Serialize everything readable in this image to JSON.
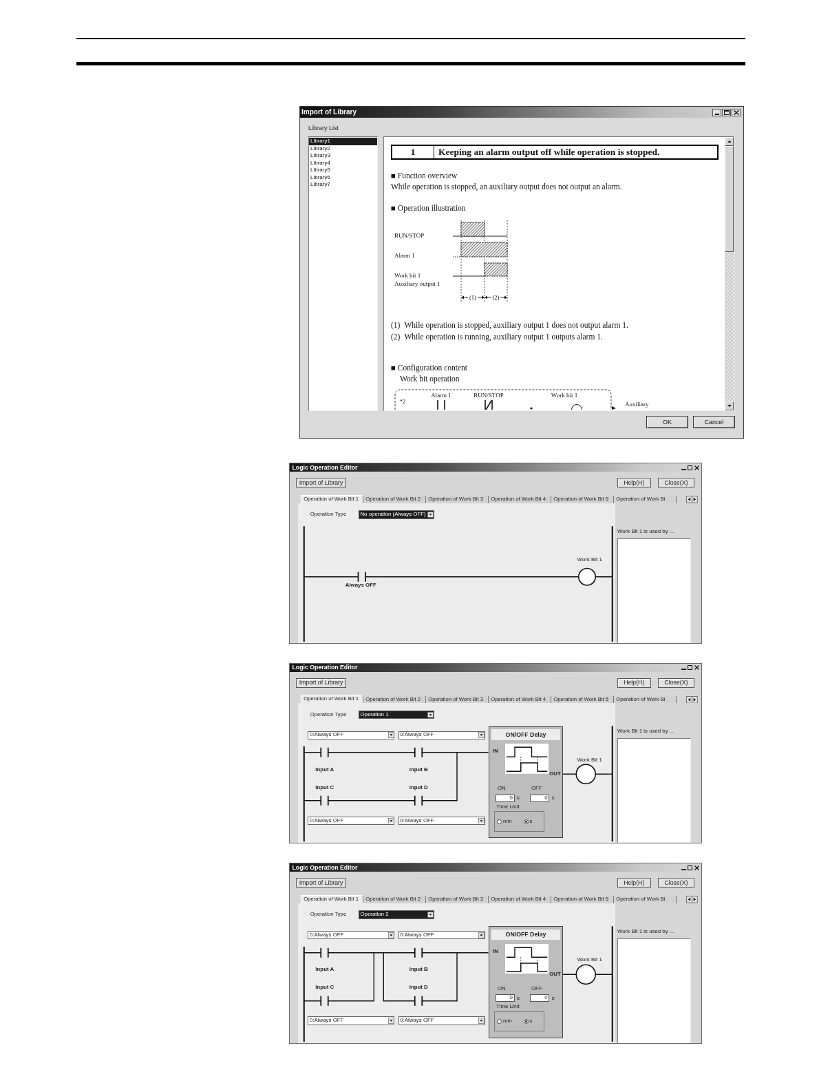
{
  "dialog": {
    "title": "Import of Library",
    "list_label": "Library List",
    "libraries": [
      {
        "label": "Library1",
        "selected": true
      },
      {
        "label": "Library2",
        "selected": false
      },
      {
        "label": "Library3",
        "selected": false
      },
      {
        "label": "Library4",
        "selected": false
      },
      {
        "label": "Library5",
        "selected": false
      },
      {
        "label": "Library6",
        "selected": false
      },
      {
        "label": "Library7",
        "selected": false
      }
    ],
    "document": {
      "number": "1",
      "heading": "Keeping an alarm output off while operation is stopped.",
      "overview_title": "■ Function overview",
      "overview_text": "While operation is stopped, an auxiliary output does not output an alarm.",
      "illustration_title": "■ Operation illustration",
      "signals": [
        {
          "label": "RUN/STOP"
        },
        {
          "label": "Alarm 1"
        },
        {
          "label": "Work bit 1",
          "sublabel": "Auxiliary output 1"
        }
      ],
      "intervals": [
        "(1)",
        "(2)"
      ],
      "notes": [
        {
          "marker": "(1)",
          "text": "While operation is stopped, auxiliary output 1 does not output alarm 1."
        },
        {
          "marker": "(2)",
          "text": "While operation is running, auxiliary output 1 outputs alarm 1."
        }
      ],
      "configuration_title": "■ Configuration content",
      "configuration_subtitle": "Work bit operation",
      "configuration_diagram": {
        "note_mark": "*2",
        "contacts": [
          {
            "label": "Alarm 1",
            "kind": "normally_open"
          },
          {
            "label": "RUN/STOP",
            "kind": "normally_closed"
          }
        ],
        "coil": "Work bit 1",
        "output": "Auxiliary"
      }
    },
    "buttons": [
      "OK",
      "Cancel"
    ]
  },
  "editors": [
    {
      "kind": "single_contact",
      "title": "Logic Operation Editor",
      "import_button": "Import of Library",
      "help_button": "Help(H)",
      "close_button": "Close(X)",
      "tabs": [
        {
          "label": "Operation of Work Bit 1",
          "selected": true
        },
        {
          "label": "Operation of Work Bit 2",
          "selected": false
        },
        {
          "label": "Operation of Work Bit 3",
          "selected": false
        },
        {
          "label": "Operation of Work Bit 4",
          "selected": false
        },
        {
          "label": "Operation of Work Bit 5",
          "selected": false
        },
        {
          "label": "Operation of Work Bi",
          "selected": false
        }
      ],
      "operation_type": {
        "label": "Operation Type",
        "value": "No operation (Always OFF)",
        "highlighted": true
      },
      "contact_label": "Always OFF",
      "coil_label": "Work Bit 1",
      "usage_title": "Work Bit 1 is used by ..."
    },
    {
      "kind": "and_or",
      "title": "Logic Operation Editor",
      "import_button": "Import of Library",
      "help_button": "Help(H)",
      "close_button": "Close(X)",
      "tabs": [
        {
          "label": "Operation of Work Bit 1",
          "selected": true
        },
        {
          "label": "Operation of Work Bit 2",
          "selected": false
        },
        {
          "label": "Operation of Work Bit 3",
          "selected": false
        },
        {
          "label": "Operation of Work Bit 4",
          "selected": false
        },
        {
          "label": "Operation of Work Bit 5",
          "selected": false
        },
        {
          "label": "Operation of Work Bi",
          "selected": false
        }
      ],
      "operation_type": {
        "label": "Operation Type",
        "value": "Operation 1",
        "highlighted": true
      },
      "inputs": [
        {
          "source": "0:Always OFF",
          "label": "Input A"
        },
        {
          "source": "0:Always OFF",
          "label": "Input B"
        },
        {
          "source": "0:Always OFF",
          "label": "Input C"
        },
        {
          "source": "0:Always OFF",
          "label": "Input D"
        }
      ],
      "delay": {
        "title": "ON/OFF Delay",
        "in_label": "IN",
        "out_label": "OUT",
        "on_label": "ON",
        "on_value": "0",
        "on_unit": "s",
        "off_label": "OFF",
        "off_value": "0",
        "off_unit": "s",
        "time_unit_label": "Time Unit",
        "time_units": [
          {
            "label": "min",
            "selected": false
          },
          {
            "label": "s",
            "selected": true
          }
        ]
      },
      "coil_label": "Work Bit 1",
      "usage_title": "Work Bit 1 is used by ..."
    },
    {
      "kind": "or_and",
      "title": "Logic Operation Editor",
      "import_button": "Import of Library",
      "help_button": "Help(H)",
      "close_button": "Close(X)",
      "tabs": [
        {
          "label": "Operation of Work Bit 1",
          "selected": true
        },
        {
          "label": "Operation of Work Bit 2",
          "selected": false
        },
        {
          "label": "Operation of Work Bit 3",
          "selected": false
        },
        {
          "label": "Operation of Work Bit 4",
          "selected": false
        },
        {
          "label": "Operation of Work Bit 5",
          "selected": false
        },
        {
          "label": "Operation of Work Bi",
          "selected": false
        }
      ],
      "operation_type": {
        "label": "Operation Type",
        "value": "Operation 2",
        "highlighted": true
      },
      "inputs": [
        {
          "source": "0:Always OFF",
          "label": "Input A"
        },
        {
          "source": "0:Always OFF",
          "label": "Input B"
        },
        {
          "source": "0:Always OFF",
          "label": "Input C"
        },
        {
          "source": "0:Always OFF",
          "label": "Input D"
        }
      ],
      "delay": {
        "title": "ON/OFF Delay",
        "in_label": "IN",
        "out_label": "OUT",
        "on_label": "ON",
        "on_value": "0",
        "on_unit": "s",
        "off_label": "OFF",
        "off_value": "0",
        "off_unit": "s",
        "time_unit_label": "Time Unit",
        "time_units": [
          {
            "label": "min",
            "selected": false
          },
          {
            "label": "s",
            "selected": true
          }
        ]
      },
      "coil_label": "Work Bit 1",
      "usage_title": "Work Bit 1 is used by ..."
    }
  ]
}
